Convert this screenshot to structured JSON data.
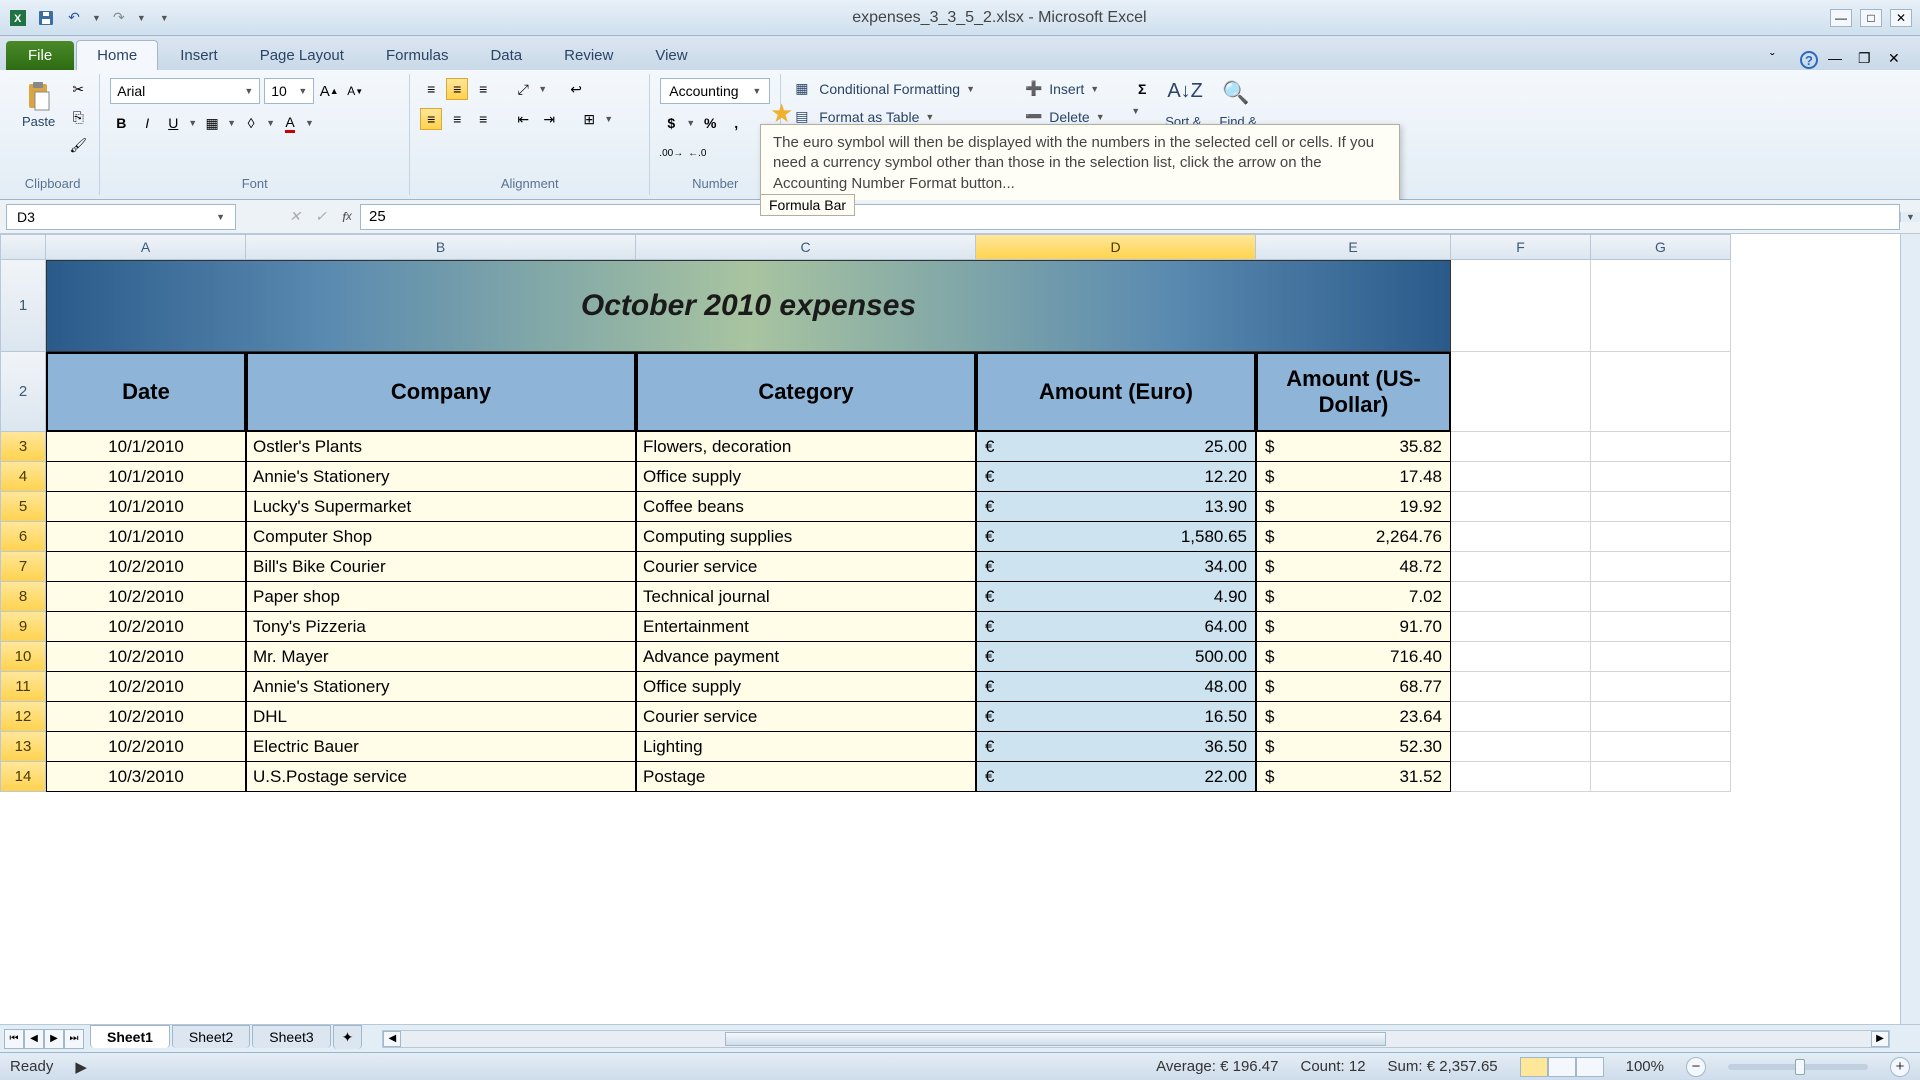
{
  "window": {
    "title": "expenses_3_3_5_2.xlsx - Microsoft Excel"
  },
  "tabs": {
    "file": "File",
    "home": "Home",
    "insert": "Insert",
    "pageLayout": "Page Layout",
    "formulas": "Formulas",
    "data": "Data",
    "review": "Review",
    "view": "View"
  },
  "ribbon": {
    "clipboard": {
      "label": "Clipboard",
      "paste": "Paste"
    },
    "font": {
      "label": "Font",
      "name": "Arial",
      "size": "10"
    },
    "alignment": {
      "label": "Alignment"
    },
    "number": {
      "label": "Number",
      "format": "Accounting"
    },
    "styles": {
      "cond": "Conditional Formatting",
      "table": "Format as Table"
    },
    "cells": {
      "insert": "Insert",
      "delete": "Delete"
    },
    "editing": {
      "sort": "Sort &",
      "find": "Find &"
    }
  },
  "tooltip": "The euro symbol will then be displayed with the numbers in the selected cell or cells. If you need a currency symbol other than those in the selection list, click the arrow on the Accounting Number Format button...",
  "formulaBarTooltip": "Formula Bar",
  "nameBox": "D3",
  "formulaValue": "25",
  "columns": [
    "A",
    "B",
    "C",
    "D",
    "E",
    "F",
    "G"
  ],
  "tableTitle": "October 2010 expenses",
  "headers": {
    "date": "Date",
    "company": "Company",
    "category": "Category",
    "euro": "Amount (Euro)",
    "usd": "Amount (US-Dollar)"
  },
  "rows": [
    {
      "n": 3,
      "date": "10/1/2010",
      "company": "Ostler's Plants",
      "category": "Flowers, decoration",
      "euro": "25.00",
      "usd": "35.82"
    },
    {
      "n": 4,
      "date": "10/1/2010",
      "company": "Annie's Stationery",
      "category": "Office supply",
      "euro": "12.20",
      "usd": "17.48"
    },
    {
      "n": 5,
      "date": "10/1/2010",
      "company": "Lucky's Supermarket",
      "category": "Coffee beans",
      "euro": "13.90",
      "usd": "19.92"
    },
    {
      "n": 6,
      "date": "10/1/2010",
      "company": "Computer Shop",
      "category": "Computing supplies",
      "euro": "1,580.65",
      "usd": "2,264.76"
    },
    {
      "n": 7,
      "date": "10/2/2010",
      "company": "Bill's Bike Courier",
      "category": "Courier service",
      "euro": "34.00",
      "usd": "48.72"
    },
    {
      "n": 8,
      "date": "10/2/2010",
      "company": "Paper shop",
      "category": "Technical journal",
      "euro": "4.90",
      "usd": "7.02"
    },
    {
      "n": 9,
      "date": "10/2/2010",
      "company": "Tony's Pizzeria",
      "category": "Entertainment",
      "euro": "64.00",
      "usd": "91.70"
    },
    {
      "n": 10,
      "date": "10/2/2010",
      "company": "Mr. Mayer",
      "category": "Advance payment",
      "euro": "500.00",
      "usd": "716.40"
    },
    {
      "n": 11,
      "date": "10/2/2010",
      "company": "Annie's Stationery",
      "category": "Office supply",
      "euro": "48.00",
      "usd": "68.77"
    },
    {
      "n": 12,
      "date": "10/2/2010",
      "company": "DHL",
      "category": "Courier service",
      "euro": "16.50",
      "usd": "23.64"
    },
    {
      "n": 13,
      "date": "10/2/2010",
      "company": "Electric Bauer",
      "category": "Lighting",
      "euro": "36.50",
      "usd": "52.30"
    },
    {
      "n": 14,
      "date": "10/3/2010",
      "company": "U.S.Postage service",
      "category": "Postage",
      "euro": "22.00",
      "usd": "31.52"
    }
  ],
  "sheets": [
    "Sheet1",
    "Sheet2",
    "Sheet3"
  ],
  "status": {
    "ready": "Ready",
    "avg": "Average:  € 196.47",
    "count": "Count: 12",
    "sum": "Sum:  € 2,357.65",
    "zoom": "100%"
  }
}
